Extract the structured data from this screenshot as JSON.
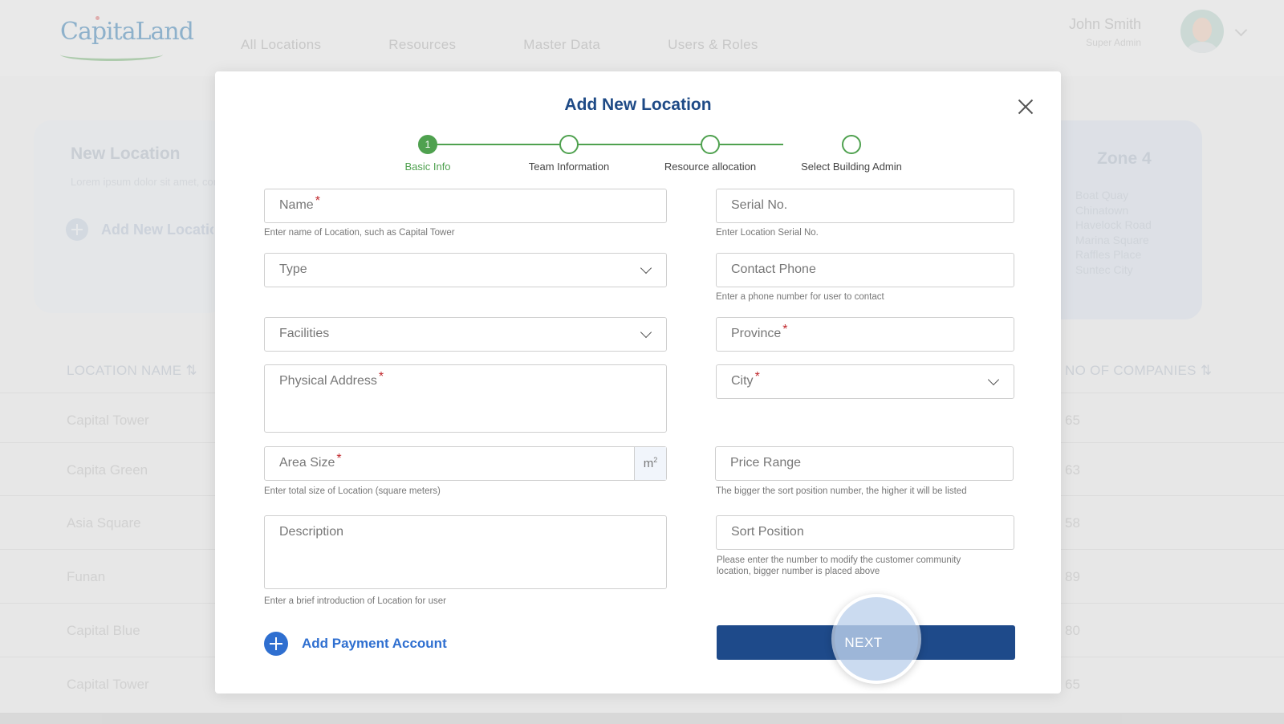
{
  "app": {
    "logo_text": "CapitaLand",
    "nav": [
      "All Locations",
      "Resources",
      "Master Data",
      "Users & Roles"
    ],
    "user": {
      "name": "John Smith",
      "role": "Super Admin"
    }
  },
  "background": {
    "new_location_card": {
      "title": "New Location",
      "description": "Lorem ipsum dolor sit amet, consetetur sadipscing elitr",
      "add_label": "Add New Location"
    },
    "zone_card": {
      "title": "Zone 4",
      "items": [
        "Boat Quay",
        "Chinatown",
        "Havelock Road",
        "Marina Square",
        "Raffles Place",
        "Suntec City"
      ]
    },
    "table": {
      "header_left": "LOCATION NAME ⇅",
      "header_right": "NO OF COMPANIES ⇅",
      "rows": [
        {
          "name": "Capital Tower",
          "companies": "65"
        },
        {
          "name": "Capita Green",
          "companies": "63"
        },
        {
          "name": "Asia Square",
          "companies": "58"
        },
        {
          "name": "Funan",
          "companies": "89"
        },
        {
          "name": "Capital Blue",
          "companies": "80"
        },
        {
          "name": "Capital Tower",
          "companies": "65"
        }
      ]
    }
  },
  "modal": {
    "title": "Add New Location",
    "steps": [
      {
        "number": "1",
        "label": "Basic Info",
        "active": true
      },
      {
        "number": "",
        "label": "Team Information",
        "active": false
      },
      {
        "number": "",
        "label": "Resource allocation",
        "active": false
      },
      {
        "number": "",
        "label": "Select Building Admin",
        "active": false
      }
    ],
    "fields": {
      "name": {
        "label": "Name",
        "required_mark": "*",
        "help": "Enter name of Location, such as Capital Tower"
      },
      "serial": {
        "label": "Serial No.",
        "help": "Enter Location Serial No."
      },
      "type": {
        "label": "Type"
      },
      "contact_phone": {
        "label": "Contact Phone",
        "help": "Enter a phone number for user to contact"
      },
      "facilities": {
        "label": "Facilities"
      },
      "province": {
        "label": "Province",
        "required_mark": "*"
      },
      "address": {
        "label": "Physical Address",
        "required_mark": "*"
      },
      "city": {
        "label": "City",
        "required_mark": "*"
      },
      "area_size": {
        "label": "Area Size",
        "required_mark": "*",
        "unit": "m",
        "unit_sup": "2",
        "help": "Enter total size of Location (square meters)"
      },
      "price_range": {
        "label": "Price Range",
        "help": "The bigger the sort position number, the higher it will be listed"
      },
      "description": {
        "label": "Description",
        "help": "Enter a brief introduction of Location for user"
      },
      "sort_position": {
        "label": "Sort Position",
        "help": "Please enter the number to modify the customer community location, bigger number is placed above"
      }
    },
    "add_payment_label": "Add Payment Account",
    "next_label": "NEXT"
  },
  "colors": {
    "primary": "#1e4a8a",
    "accent": "#2f6fd0",
    "step_green": "#4fa14f",
    "required": "#c0282d"
  },
  "icons": {
    "close": "close-icon",
    "dropdown": "chevron-down-icon",
    "add": "plus-circle-icon"
  }
}
